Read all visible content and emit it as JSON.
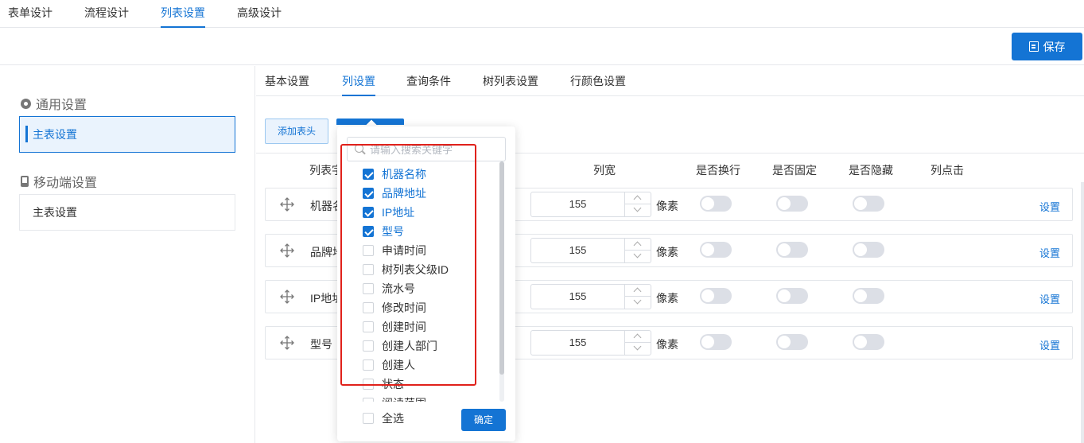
{
  "top_tabs": [
    {
      "label": "表单设计"
    },
    {
      "label": "流程设计"
    },
    {
      "label": "列表设置",
      "active": true
    },
    {
      "label": "高级设计"
    }
  ],
  "toolbar": {
    "save_label": "保存"
  },
  "left_panel": {
    "general": {
      "title": "通用设置",
      "item": "主表设置"
    },
    "mobile": {
      "title": "移动端设置",
      "item": "主表设置"
    }
  },
  "sub_tabs": [
    {
      "label": "基本设置"
    },
    {
      "label": "列设置",
      "active": true
    },
    {
      "label": "查询条件"
    },
    {
      "label": "树列表设置"
    },
    {
      "label": "行颜色设置"
    }
  ],
  "add_header_label": "添加表头",
  "columns_header": {
    "field": "列表字",
    "width": "列宽",
    "wrap": "是否换行",
    "fixed": "是否固定",
    "hidden": "是否隐藏",
    "click": "列点击"
  },
  "rows": [
    {
      "name": "机器名称",
      "width": "155",
      "unit": "像素",
      "action": "设置"
    },
    {
      "name": "品牌地址",
      "width": "155",
      "unit": "像素",
      "action": "设置"
    },
    {
      "name": "IP地址",
      "width": "155",
      "unit": "像素",
      "action": "设置"
    },
    {
      "name": "型号",
      "width": "155",
      "unit": "像素",
      "action": "设置"
    }
  ],
  "dropdown": {
    "search_placeholder": "请输入搜索关键字",
    "options": [
      {
        "label": "机器名称",
        "checked": true
      },
      {
        "label": "品牌地址",
        "checked": true
      },
      {
        "label": "IP地址",
        "checked": true
      },
      {
        "label": "型号",
        "checked": true
      },
      {
        "label": "申请时间",
        "checked": false
      },
      {
        "label": "树列表父级ID",
        "checked": false
      },
      {
        "label": "流水号",
        "checked": false
      },
      {
        "label": "修改时间",
        "checked": false
      },
      {
        "label": "创建时间",
        "checked": false
      },
      {
        "label": "创建人部门",
        "checked": false
      },
      {
        "label": "创建人",
        "checked": false
      },
      {
        "label": "状态",
        "checked": false
      },
      {
        "label": "阅读范围",
        "checked": false
      }
    ],
    "select_all": "全选",
    "confirm": "确定"
  },
  "colors": {
    "accent": "#1474d4",
    "highlight_box": "#e0211b"
  }
}
